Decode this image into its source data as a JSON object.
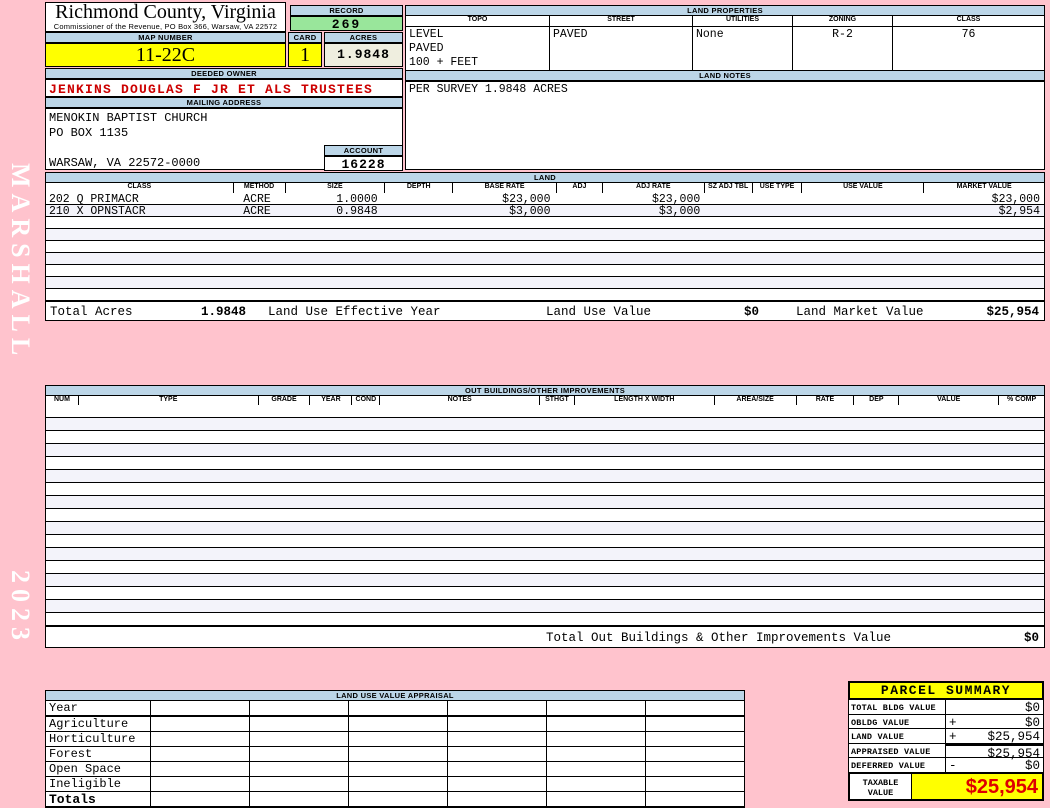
{
  "county": {
    "title": "Richmond County, Virginia",
    "subtitle": "Commissioner of the Revenue, PO Box 366, Warsaw, VA 22572"
  },
  "sidebar": {
    "name": "MARSHALL",
    "year": "2023"
  },
  "record": {
    "label": "RECORD",
    "value": "269"
  },
  "map_number": {
    "label": "MAP NUMBER",
    "value": "11-22C"
  },
  "card": {
    "label": "CARD",
    "value": "1"
  },
  "acres": {
    "label": "ACRES",
    "value": "1.9848"
  },
  "land_properties": {
    "title": "LAND PROPERTIES",
    "columns": [
      "TOPO",
      "STREET",
      "UTILITIES",
      "ZONING",
      "CLASS"
    ],
    "topo_lines": [
      "LEVEL",
      "PAVED",
      "100 + FEET"
    ],
    "street": "PAVED",
    "utilities": "None",
    "zoning": "R-2",
    "class": "76"
  },
  "deeded_owner": {
    "label": "DEEDED OWNER",
    "value": "JENKINS DOUGLAS F JR ET ALS TRUSTEES"
  },
  "mailing_address": {
    "label": "MAILING ADDRESS",
    "lines": [
      "MENOKIN BAPTIST CHURCH",
      "PO BOX 1135",
      "",
      "WARSAW, VA 22572-0000"
    ]
  },
  "account": {
    "label": "ACCOUNT",
    "value": "16228"
  },
  "land_notes": {
    "title": "LAND NOTES",
    "text": "PER SURVEY 1.9848 ACRES"
  },
  "land_table": {
    "title": "LAND",
    "columns": [
      "CLASS",
      "METHOD",
      "SIZE",
      "DEPTH",
      "BASE RATE",
      "ADJ",
      "ADJ RATE",
      "SZ ADJ TBL",
      "USE TYPE",
      "USE VALUE",
      "MARKET VALUE"
    ],
    "rows": [
      [
        "202 Q PRIMACR",
        "ACRE",
        "1.0000",
        "",
        "$23,000",
        "",
        "$23,000",
        "",
        "",
        "",
        "$23,000"
      ],
      [
        "210 X OPNSTACR",
        "ACRE",
        "0.9848",
        "",
        "$3,000",
        "",
        "$3,000",
        "",
        "",
        "",
        "$2,954"
      ]
    ],
    "empty_row_count": 7,
    "totals": {
      "acres_label": "Total Acres",
      "acres": "1.9848",
      "effective_year_label": "Land Use Effective Year",
      "use_value_label": "Land Use Value",
      "use_value": "$0",
      "market_value_label": "Land Market Value",
      "market_value": "$25,954"
    }
  },
  "out_buildings": {
    "title": "OUT BUILDINGS/OTHER IMPROVEMENTS",
    "columns": [
      "NUM",
      "TYPE",
      "GRADE",
      "YEAR",
      "COND",
      "NOTES",
      "STHGT",
      "LENGTH X WIDTH",
      "AREA/SIZE",
      "RATE",
      "DEP",
      "VALUE",
      "% COMP"
    ],
    "empty_row_count": 17,
    "total_label": "Total Out Buildings & Other Improvements Value",
    "total_value": "$0"
  },
  "land_use_appraisal": {
    "title": "LAND USE VALUE APPRAISAL",
    "row_labels": [
      "Year",
      "Agriculture",
      "Horticulture",
      "Forest",
      "Open Space",
      "Ineligible",
      "Totals"
    ],
    "column_count": 6
  },
  "parcel_summary": {
    "title": "PARCEL SUMMARY",
    "rows": [
      {
        "label": "TOTAL BLDG VALUE",
        "sign": "",
        "value": "$0"
      },
      {
        "label": "OBLDG VALUE",
        "sign": "+",
        "value": "$0"
      },
      {
        "label": "LAND VALUE",
        "sign": "+",
        "value": "$25,954"
      },
      {
        "label": "APPRAISED VALUE",
        "sign": "",
        "value": "$25,954"
      },
      {
        "label": "DEFERRED VALUE",
        "sign": "-",
        "value": "$0"
      }
    ],
    "taxable": {
      "label_line1": "TAXABLE",
      "label_line2": "VALUE",
      "value": "$25,954"
    }
  },
  "colors": {
    "page_pink": "#FFC3CD",
    "header_blue": "#BCD6E8",
    "record_green": "#99E69B",
    "highlight_yellow": "#FFFF00",
    "acres_cream": "#EFEEDF",
    "owner_red": "#CC0000",
    "taxable_red": "#DD0000",
    "row_stripe": "#F3F3FA"
  }
}
